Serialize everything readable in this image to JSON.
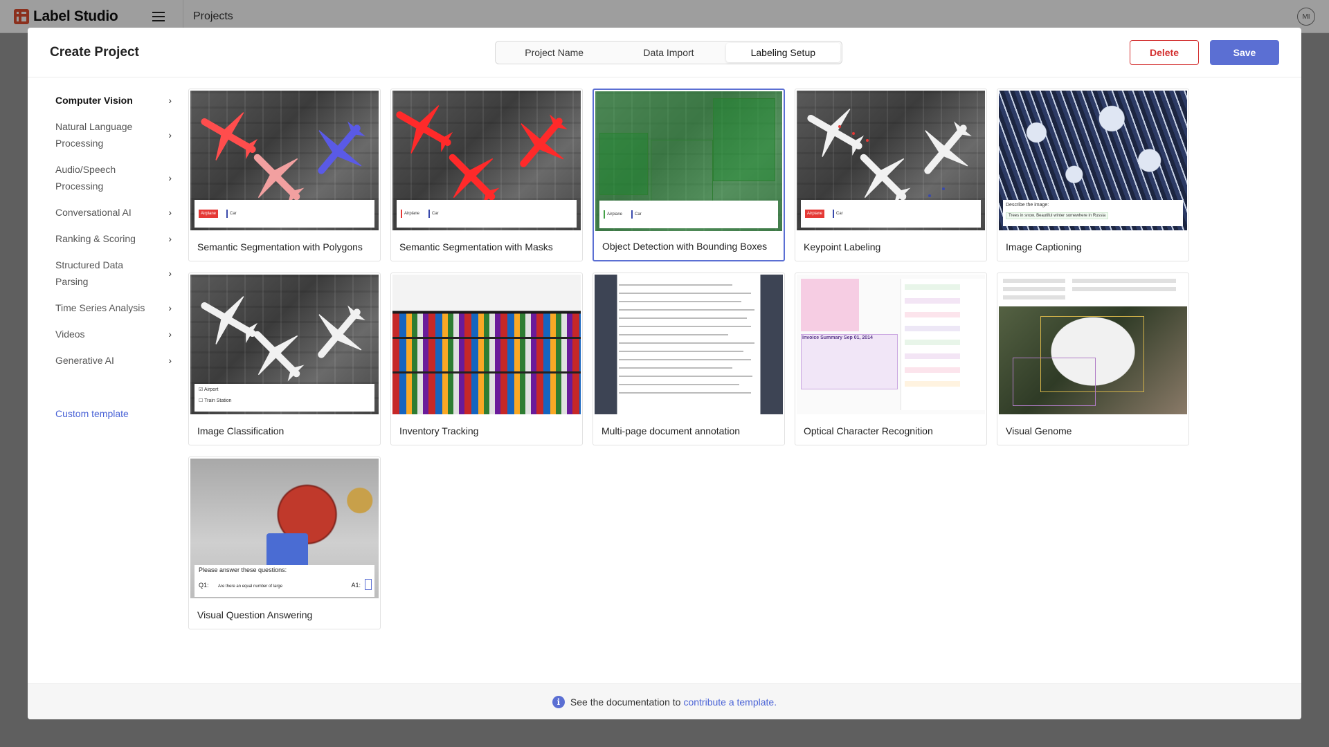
{
  "app": {
    "name": "Label Studio",
    "breadcrumb": "Projects",
    "avatar_initials": "MI",
    "brand_color": "#e04e2f"
  },
  "modal": {
    "title": "Create Project",
    "tabs": [
      {
        "label": "Project Name",
        "active": false
      },
      {
        "label": "Data Import",
        "active": false
      },
      {
        "label": "Labeling Setup",
        "active": true
      }
    ],
    "delete_label": "Delete",
    "save_label": "Save",
    "accent_color": "#5b6fd3",
    "danger_color": "#d32f2f"
  },
  "sidebar": {
    "items": [
      {
        "label": "Computer Vision",
        "active": true,
        "icon": "chevron-right-icon"
      },
      {
        "label": "Natural Language Processing",
        "active": false,
        "icon": "chevron-right-icon"
      },
      {
        "label": "Audio/Speech Processing",
        "active": false,
        "icon": "chevron-right-icon"
      },
      {
        "label": "Conversational AI",
        "active": false,
        "icon": "chevron-right-icon"
      },
      {
        "label": "Ranking & Scoring",
        "active": false,
        "icon": "chevron-right-icon"
      },
      {
        "label": "Structured Data Parsing",
        "active": false,
        "icon": "chevron-right-icon"
      },
      {
        "label": "Time Series Analysis",
        "active": false,
        "icon": "chevron-right-icon"
      },
      {
        "label": "Videos",
        "active": false,
        "icon": "chevron-right-icon"
      },
      {
        "label": "Generative AI",
        "active": false,
        "icon": "chevron-right-icon"
      }
    ],
    "custom_template": "Custom template"
  },
  "templates": [
    {
      "title": "Semantic Segmentation with Polygons",
      "selected": false
    },
    {
      "title": "Semantic Segmentation with Masks",
      "selected": false
    },
    {
      "title": "Object Detection with Bounding Boxes",
      "selected": true
    },
    {
      "title": "Keypoint Labeling",
      "selected": false
    },
    {
      "title": "Image Captioning",
      "selected": false
    },
    {
      "title": "Image Classification",
      "selected": false
    },
    {
      "title": "Inventory Tracking",
      "selected": false
    },
    {
      "title": "Multi-page document annotation",
      "selected": false
    },
    {
      "title": "Optical Character Recognition",
      "selected": false
    },
    {
      "title": "Visual Genome",
      "selected": false
    },
    {
      "title": "Visual Question Answering",
      "selected": false
    }
  ],
  "thumb_text": {
    "airplane": "Airplane",
    "car": "Car",
    "airport": "Airport",
    "train_station": "Train Station",
    "describe": "Describe the image:",
    "caption": "Trees in snow. Beautiful winter somewhere in Russia",
    "vqa_prompt": "Please answer these questions:",
    "q1": "Q1:",
    "a1": "A1:",
    "q1_text": "Are there an equal number of large",
    "ocr_heading": "Invoice Summary Sep 01, 2014"
  },
  "footer": {
    "text": "See the documentation to",
    "link": "contribute a template.",
    "icon": "info-icon"
  }
}
